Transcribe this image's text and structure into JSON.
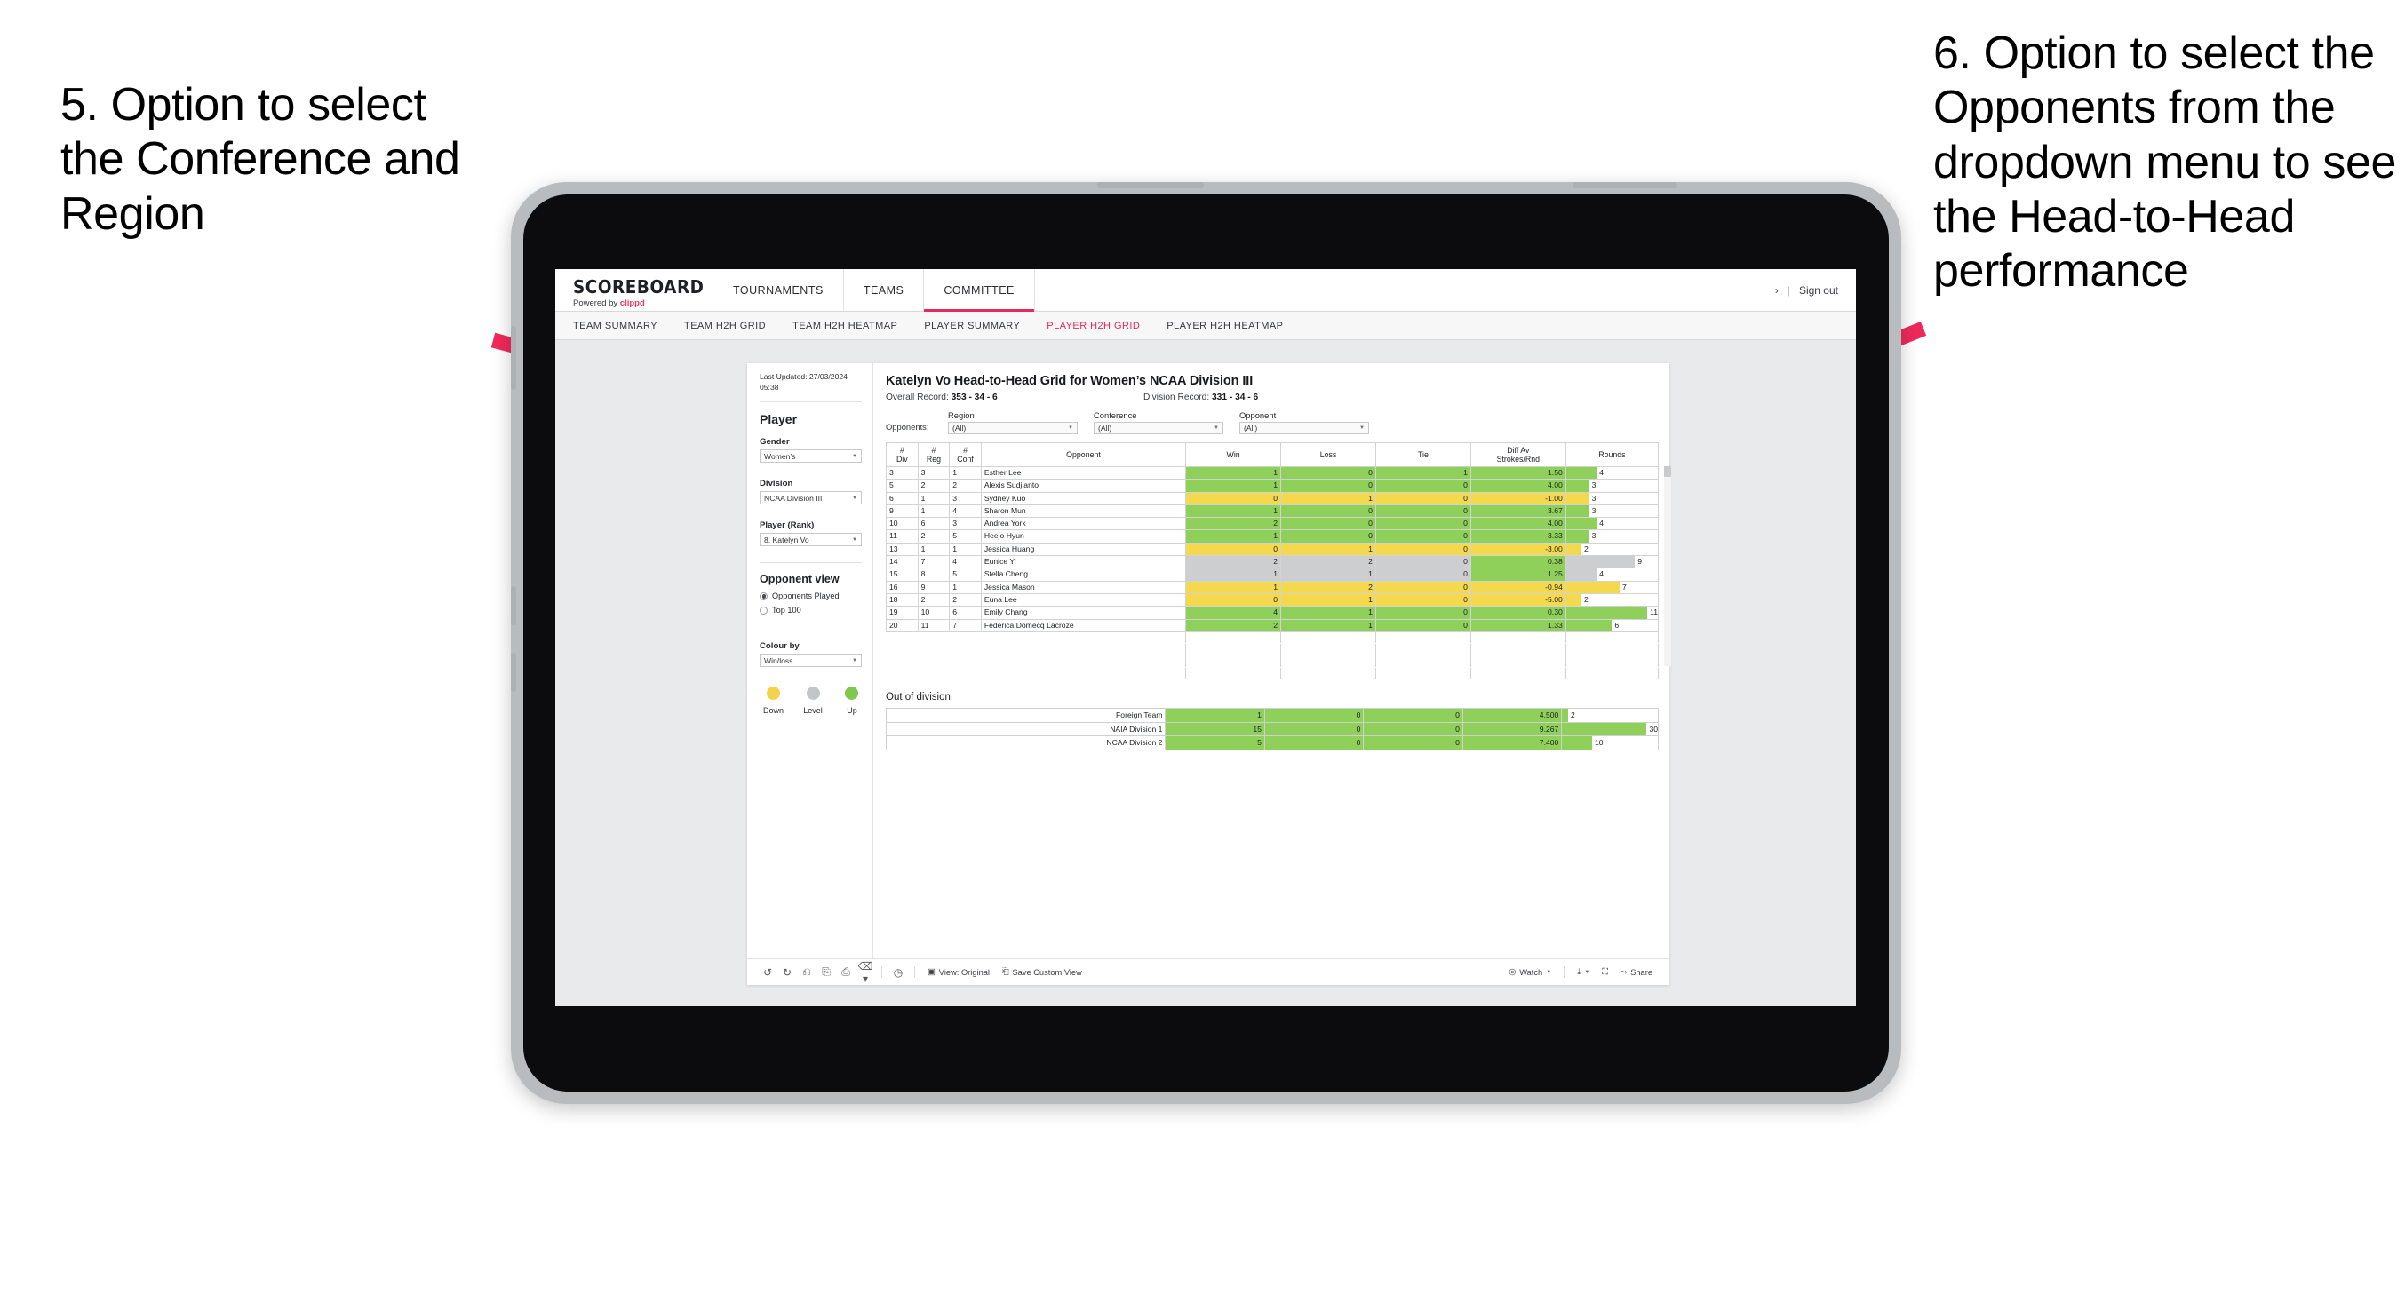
{
  "annotations": {
    "left": "5. Option to select the Conference and Region",
    "right": "6. Option to select the Opponents from the dropdown menu to see the Head-to-Head performance",
    "arrow_color": "#ef2a5b"
  },
  "topnav": {
    "brand_title": "SCOREBOARD",
    "brand_sub_prefix": "Powered by",
    "brand_sub_name": "clippd",
    "items": [
      {
        "label": "TOURNAMENTS",
        "active": false
      },
      {
        "label": "TEAMS",
        "active": false
      },
      {
        "label": "COMMITTEE",
        "active": true
      }
    ],
    "chevron": "›",
    "separator": "|",
    "signout": "Sign out",
    "accent": "#e4295b"
  },
  "subnav": {
    "items": [
      {
        "label": "TEAM SUMMARY",
        "active": false
      },
      {
        "label": "TEAM H2H GRID",
        "active": false
      },
      {
        "label": "TEAM H2H HEATMAP",
        "active": false
      },
      {
        "label": "PLAYER SUMMARY",
        "active": false
      },
      {
        "label": "PLAYER H2H GRID",
        "active": true
      },
      {
        "label": "PLAYER H2H HEATMAP",
        "active": false
      }
    ]
  },
  "filters": {
    "last_updated": "Last Updated: 27/03/2024 05:38",
    "heading": "Player",
    "gender": {
      "label": "Gender",
      "value": "Women’s"
    },
    "division": {
      "label": "Division",
      "value": "NCAA Division III"
    },
    "player_rank": {
      "label": "Player (Rank)",
      "value": "8. Katelyn Vo"
    },
    "opponent_view": {
      "heading": "Opponent view",
      "options": [
        {
          "label": "Opponents Played",
          "selected": true
        },
        {
          "label": "Top 100",
          "selected": false
        }
      ]
    },
    "colour_by": {
      "label": "Colour by",
      "value": "Win/loss"
    },
    "legend": [
      {
        "label": "Down",
        "color": "#f4d34a"
      },
      {
        "label": "Level",
        "color": "#c3c6c8"
      },
      {
        "label": "Up",
        "color": "#7ec850"
      }
    ]
  },
  "viz": {
    "title": "Katelyn Vo Head-to-Head Grid for Women’s NCAA Division III",
    "overall_record_label": "Overall Record:",
    "overall_record_value": "353 -  34 - 6",
    "division_record_label": "Division Record:",
    "division_record_value": "331 -  34 - 6",
    "opponents_label": "Opponents:",
    "dropdowns": [
      {
        "label": "Region",
        "value": "(All)"
      },
      {
        "label": "Conference",
        "value": "(All)"
      },
      {
        "label": "Opponent",
        "value": "(All)"
      }
    ]
  },
  "chart_data": {
    "type": "table",
    "title": "Katelyn Vo Head-to-Head Grid for Women’s NCAA Division III",
    "colors": {
      "up": "#8fd05a",
      "down": "#f4d94f",
      "level": "#cdced0",
      "white": "#ffffff"
    },
    "columns": [
      "# Div",
      "# Reg",
      "# Conf",
      "Opponent",
      "Win",
      "Loss",
      "Tie",
      "Diff Av Strokes/Rnd",
      "Rounds"
    ],
    "column_headers_two_line": [
      {
        "l1": "#",
        "l2": "Div"
      },
      {
        "l1": "#",
        "l2": "Reg"
      },
      {
        "l1": "#",
        "l2": "Conf"
      },
      {
        "l1": "Opponent",
        "l2": ""
      },
      {
        "l1": "Win",
        "l2": ""
      },
      {
        "l1": "Loss",
        "l2": ""
      },
      {
        "l1": "Tie",
        "l2": ""
      },
      {
        "l1": "Diff Av",
        "l2": "Strokes/Rnd"
      },
      {
        "l1": "Rounds",
        "l2": ""
      }
    ],
    "rounds_max": 12,
    "rows": [
      {
        "div": "3",
        "reg": "3",
        "conf": "1",
        "opponent": "Esther Lee",
        "win": "1",
        "loss": "0",
        "tie": "1",
        "diff": "1.50",
        "rounds": "4",
        "color": "up"
      },
      {
        "div": "5",
        "reg": "2",
        "conf": "2",
        "opponent": "Alexis Sudjianto",
        "win": "1",
        "loss": "0",
        "tie": "0",
        "diff": "4.00",
        "rounds": "3",
        "color": "up"
      },
      {
        "div": "6",
        "reg": "1",
        "conf": "3",
        "opponent": "Sydney Kuo",
        "win": "0",
        "loss": "1",
        "tie": "0",
        "diff": "-1.00",
        "rounds": "3",
        "color": "down"
      },
      {
        "div": "9",
        "reg": "1",
        "conf": "4",
        "opponent": "Sharon Mun",
        "win": "1",
        "loss": "0",
        "tie": "0",
        "diff": "3.67",
        "rounds": "3",
        "color": "up"
      },
      {
        "div": "10",
        "reg": "6",
        "conf": "3",
        "opponent": "Andrea York",
        "win": "2",
        "loss": "0",
        "tie": "0",
        "diff": "4.00",
        "rounds": "4",
        "color": "up"
      },
      {
        "div": "11",
        "reg": "2",
        "conf": "5",
        "opponent": "Heejo Hyun",
        "win": "1",
        "loss": "0",
        "tie": "0",
        "diff": "3.33",
        "rounds": "3",
        "color": "up"
      },
      {
        "div": "13",
        "reg": "1",
        "conf": "1",
        "opponent": "Jessica Huang",
        "win": "0",
        "loss": "1",
        "tie": "0",
        "diff": "-3.00",
        "rounds": "2",
        "color": "down"
      },
      {
        "div": "14",
        "reg": "7",
        "conf": "4",
        "opponent": "Eunice Yi",
        "win": "2",
        "loss": "2",
        "tie": "0",
        "diff": "0.38",
        "rounds": "9",
        "color": "level",
        "diff_color": "up"
      },
      {
        "div": "15",
        "reg": "8",
        "conf": "5",
        "opponent": "Stella Cheng",
        "win": "1",
        "loss": "1",
        "tie": "0",
        "diff": "1.25",
        "rounds": "4",
        "color": "level",
        "diff_color": "up"
      },
      {
        "div": "16",
        "reg": "9",
        "conf": "1",
        "opponent": "Jessica Mason",
        "win": "1",
        "loss": "2",
        "tie": "0",
        "diff": "-0.94",
        "rounds": "7",
        "color": "down"
      },
      {
        "div": "18",
        "reg": "2",
        "conf": "2",
        "opponent": "Euna Lee",
        "win": "0",
        "loss": "1",
        "tie": "0",
        "diff": "-5.00",
        "rounds": "2",
        "color": "down"
      },
      {
        "div": "19",
        "reg": "10",
        "conf": "6",
        "opponent": "Emily Chang",
        "win": "4",
        "loss": "1",
        "tie": "0",
        "diff": "0.30",
        "rounds": "11",
        "color": "up"
      },
      {
        "div": "20",
        "reg": "11",
        "conf": "7",
        "opponent": "Federica Domecq Lacroze",
        "win": "2",
        "loss": "1",
        "tie": "0",
        "diff": "1.33",
        "rounds": "6",
        "color": "up"
      }
    ],
    "out_of_division": {
      "title": "Out of division",
      "rounds_max": 32,
      "rows": [
        {
          "name": "Foreign Team",
          "win": "1",
          "loss": "0",
          "tie": "0",
          "diff": "4.500",
          "rounds": "2",
          "color": "up"
        },
        {
          "name": "NAIA Division 1",
          "win": "15",
          "loss": "0",
          "tie": "0",
          "diff": "9.267",
          "rounds": "30",
          "color": "up"
        },
        {
          "name": "NCAA Division 2",
          "win": "5",
          "loss": "0",
          "tie": "0",
          "diff": "7.400",
          "rounds": "10",
          "color": "up"
        }
      ]
    }
  },
  "toolbar": {
    "view_label": "View: Original",
    "save_label": "Save Custom View",
    "watch_label": "Watch",
    "share_label": "Share"
  }
}
